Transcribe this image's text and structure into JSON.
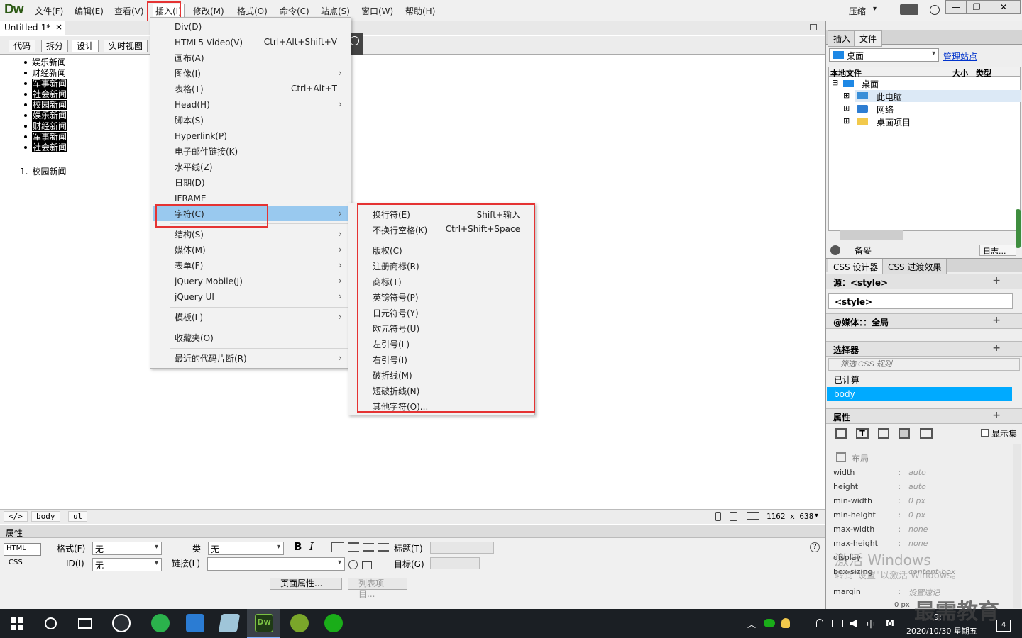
{
  "app": {
    "logo": "Dw"
  },
  "menubar": {
    "items": [
      "文件(F)",
      "编辑(E)",
      "查看(V)",
      "插入(I)",
      "修改(M)",
      "格式(O)",
      "命令(C)",
      "站点(S)",
      "窗口(W)",
      "帮助(H)"
    ],
    "compress": "压缩",
    "compress_arrow": "▾",
    "window_minimize": "—",
    "window_restore": "❐",
    "window_close": "✕"
  },
  "doc": {
    "tab_title": "Untitled-1*",
    "tab_close": "×",
    "views": [
      "代码",
      "拆分",
      "设计",
      "实时视图"
    ],
    "active_view": "设计"
  },
  "design": {
    "bullet_items": [
      "娱乐新闻",
      "财经新闻",
      "军事新闻",
      "社会新闻",
      "校园新闻",
      "娱乐新闻",
      "财经新闻",
      "军事新闻",
      "社会新闻"
    ],
    "ordered_number": "1.",
    "ordered_item": "校园新闻"
  },
  "insert_menu": {
    "items": [
      {
        "label": "Div(D)",
        "shortcut": "",
        "arrow": ""
      },
      {
        "label": "HTML5 Video(V)",
        "shortcut": "Ctrl+Alt+Shift+V",
        "arrow": ""
      },
      {
        "label": "画布(A)",
        "shortcut": "",
        "arrow": ""
      },
      {
        "label": "图像(I)",
        "shortcut": "",
        "arrow": "›"
      },
      {
        "label": "表格(T)",
        "shortcut": "Ctrl+Alt+T",
        "arrow": ""
      },
      {
        "label": "Head(H)",
        "shortcut": "",
        "arrow": "›"
      },
      {
        "label": "脚本(S)",
        "shortcut": "",
        "arrow": ""
      },
      {
        "label": "Hyperlink(P)",
        "shortcut": "",
        "arrow": ""
      },
      {
        "label": "电子邮件链接(K)",
        "shortcut": "",
        "arrow": ""
      },
      {
        "label": "水平线(Z)",
        "shortcut": "",
        "arrow": ""
      },
      {
        "label": "日期(D)",
        "shortcut": "",
        "arrow": ""
      },
      {
        "label": "IFRAME",
        "shortcut": "",
        "arrow": ""
      },
      {
        "label": "字符(C)",
        "shortcut": "",
        "arrow": "›"
      },
      {
        "label": "结构(S)",
        "shortcut": "",
        "arrow": "›"
      },
      {
        "label": "媒体(M)",
        "shortcut": "",
        "arrow": "›"
      },
      {
        "label": "表单(F)",
        "shortcut": "",
        "arrow": "›"
      },
      {
        "label": "jQuery Mobile(J)",
        "shortcut": "",
        "arrow": "›"
      },
      {
        "label": "jQuery UI",
        "shortcut": "",
        "arrow": "›"
      },
      {
        "label": "模板(L)",
        "shortcut": "",
        "arrow": "›"
      },
      {
        "label": "收藏夹(O)",
        "shortcut": "",
        "arrow": ""
      },
      {
        "label": "最近的代码片断(R)",
        "shortcut": "",
        "arrow": "›"
      }
    ]
  },
  "char_submenu": {
    "items": [
      {
        "label": "换行符(E)",
        "shortcut": "Shift+输入"
      },
      {
        "label": "不换行空格(K)",
        "shortcut": "Ctrl+Shift+Space"
      },
      {
        "label": "版权(C)",
        "shortcut": ""
      },
      {
        "label": "注册商标(R)",
        "shortcut": ""
      },
      {
        "label": "商标(T)",
        "shortcut": ""
      },
      {
        "label": "英镑符号(P)",
        "shortcut": ""
      },
      {
        "label": "日元符号(Y)",
        "shortcut": ""
      },
      {
        "label": "欧元符号(U)",
        "shortcut": ""
      },
      {
        "label": "左引号(L)",
        "shortcut": ""
      },
      {
        "label": "右引号(I)",
        "shortcut": ""
      },
      {
        "label": "破折线(M)",
        "shortcut": ""
      },
      {
        "label": "短破折线(N)",
        "shortcut": ""
      },
      {
        "label": "其他字符(O)...",
        "shortcut": ""
      }
    ]
  },
  "statusbar": {
    "code_toggle": "</>",
    "tags": [
      "body",
      "ul"
    ],
    "size": "1162 x 638",
    "size_arrow": "▾"
  },
  "properties": {
    "title": "属性",
    "html_btn": "HTML",
    "css_btn": "CSS",
    "format_label": "格式(F)",
    "format_value": "无",
    "class_label": "类",
    "class_value": "无",
    "id_label": "ID(I)",
    "id_value": "无",
    "link_label": "链接(L)",
    "link_value": "",
    "bold": "B",
    "italic": "I",
    "title_label": "标题(T)",
    "target_label": "目标(G)",
    "page_props": "页面属性...",
    "list_item": "列表项目...",
    "help": "?"
  },
  "files_panel": {
    "tabs": [
      "插入",
      "文件"
    ],
    "location": "桌面",
    "manage": "管理站点",
    "col_local": "本地文件",
    "col_size": "大小",
    "col_type": "类型",
    "tree": [
      {
        "label": "桌面",
        "expander": "⊟"
      },
      {
        "label": "此电脑",
        "expander": "⊞"
      },
      {
        "label": "网络",
        "expander": "⊞"
      },
      {
        "label": "桌面项目",
        "expander": "⊞"
      }
    ],
    "footer_left": "备妥",
    "footer_right": "日志..."
  },
  "css_panel": {
    "tabs": [
      "CSS 设计器",
      "CSS 过渡效果"
    ],
    "source_label": "源：<style>",
    "source_item": "<style>",
    "media_label": "@媒体：：全局",
    "selector_label": "选择器",
    "filter_placeholder": "筛选 CSS 规则",
    "computed": "已计算",
    "selected": "body",
    "props_label": "属性",
    "show_set": "显示集",
    "layout_label": "布局",
    "plus": "+",
    "rows": [
      {
        "name": "width",
        "value": "auto"
      },
      {
        "name": "height",
        "value": "auto"
      },
      {
        "name": "min-width",
        "value": "0 px"
      },
      {
        "name": "min-height",
        "value": "0 px"
      },
      {
        "name": "max-width",
        "value": "none"
      },
      {
        "name": "max-height",
        "value": "none"
      },
      {
        "name": "display",
        "value": ""
      },
      {
        "name": "box-sizing",
        "value": "content-box"
      },
      {
        "name": "margin",
        "value": "设置速记"
      }
    ],
    "margin_sub": "0 px"
  },
  "watermark": {
    "line1": "激活 Windows",
    "line2": "转到\"设置\"以激活 Windows。",
    "brand": "最需教育"
  },
  "taskbar": {
    "ime": "中",
    "ime2": "M",
    "time": "9:",
    "date": "2020/10/30 星期五",
    "notif": "4"
  }
}
